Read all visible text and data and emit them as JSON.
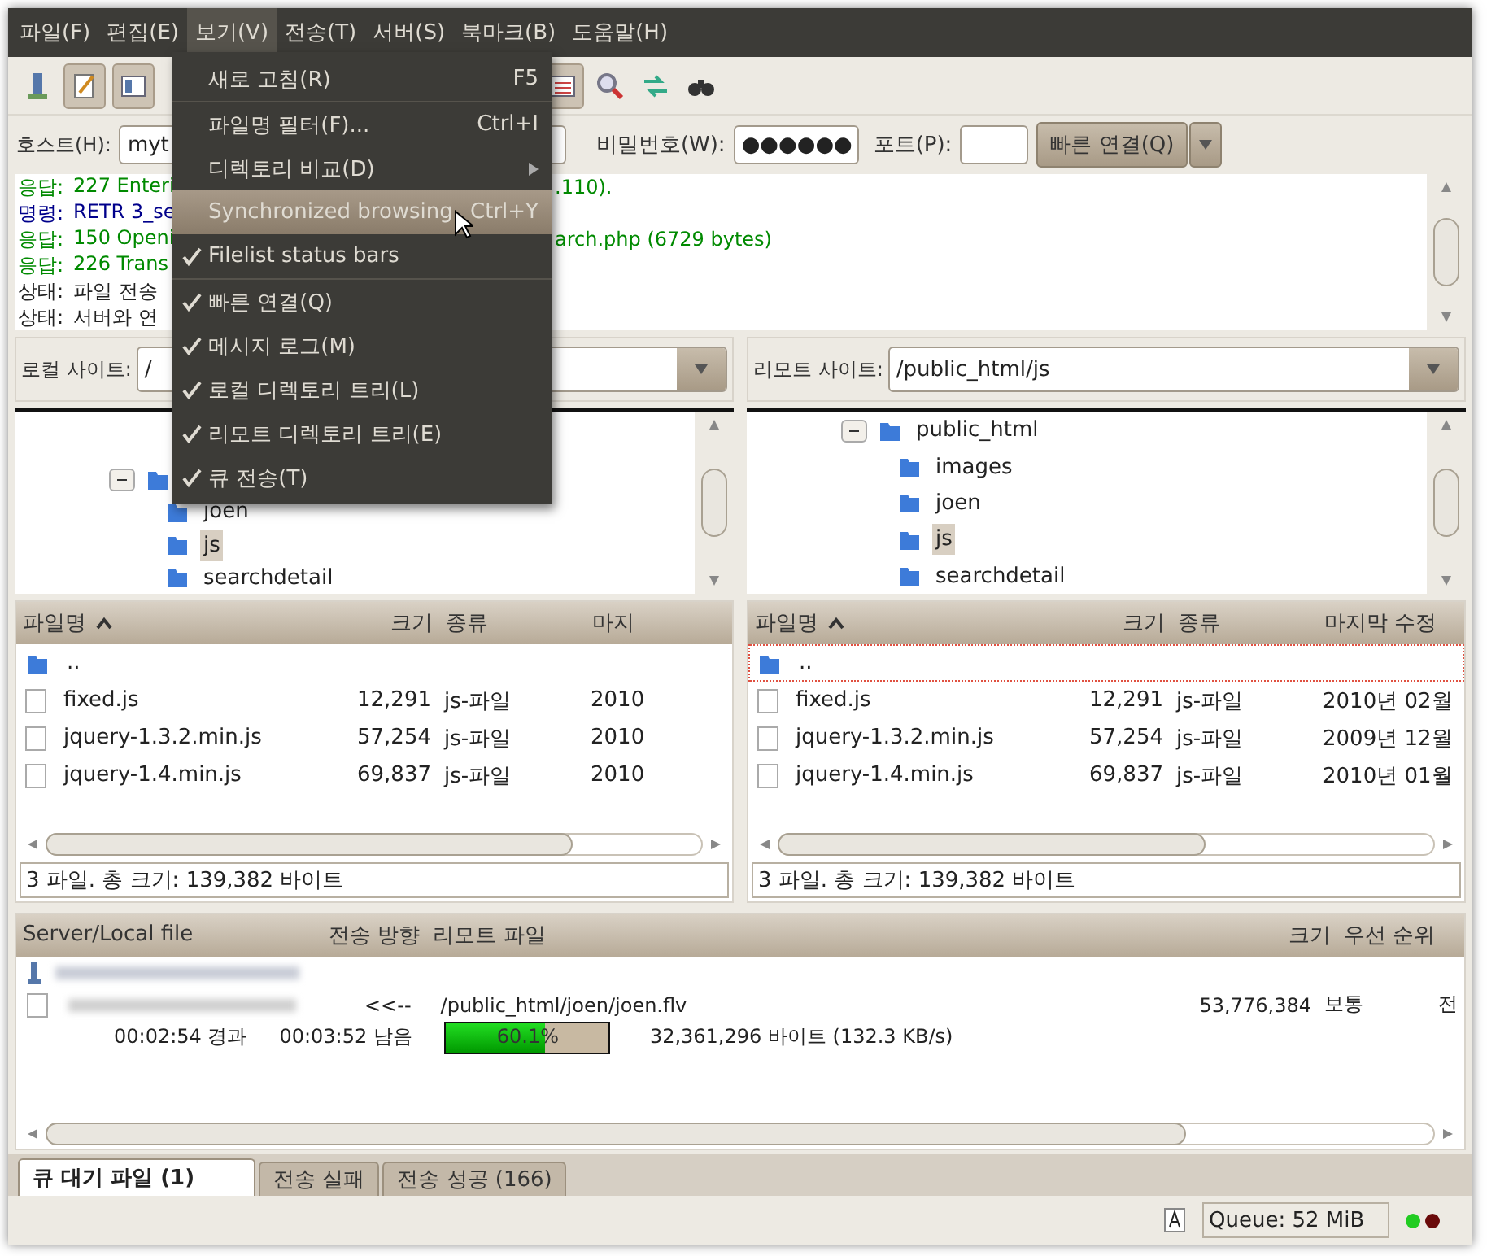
{
  "menubar": [
    {
      "label": "파일(F)",
      "selected": false
    },
    {
      "label": "편집(E)",
      "selected": false
    },
    {
      "label": "보기(V)",
      "selected": true
    },
    {
      "label": "전송(T)",
      "selected": false
    },
    {
      "label": "서버(S)",
      "selected": false
    },
    {
      "label": "북마크(B)",
      "selected": false
    },
    {
      "label": "도움말(H)",
      "selected": false
    }
  ],
  "view_menu": [
    {
      "kind": "item",
      "label": "새로 고침(R)",
      "shortcut": "F5",
      "checked": false,
      "highlighted": false
    },
    {
      "kind": "separator"
    },
    {
      "kind": "item",
      "label": "파일명 필터(F)...",
      "shortcut": "Ctrl+I",
      "checked": false,
      "highlighted": false
    },
    {
      "kind": "submenu",
      "label": "디렉토리 비교(D)",
      "checked": false,
      "highlighted": false
    },
    {
      "kind": "item",
      "label": "Synchronized browsing",
      "shortcut": "Ctrl+Y",
      "checked": false,
      "highlighted": true
    },
    {
      "kind": "item",
      "label": "Filelist status bars",
      "checked": true,
      "highlighted": false
    },
    {
      "kind": "separator"
    },
    {
      "kind": "item",
      "label": "빠른 연결(Q)",
      "checked": true,
      "highlighted": false
    },
    {
      "kind": "item",
      "label": "메시지 로그(M)",
      "checked": true,
      "highlighted": false
    },
    {
      "kind": "item",
      "label": "로컬 디렉토리 트리(L)",
      "checked": true,
      "highlighted": false
    },
    {
      "kind": "item",
      "label": "리모트 디렉토리 트리(E)",
      "checked": true,
      "highlighted": false
    },
    {
      "kind": "item",
      "label": "큐 전송(T)",
      "checked": true,
      "highlighted": false
    }
  ],
  "quickconnect": {
    "host_label": "호스트(H):",
    "host_value": "myt",
    "password_label": "비밀번호(W):",
    "password_value": "●●●●●●",
    "port_label": "포트(P):",
    "connect_button": "빠른 연결(Q)"
  },
  "log": [
    {
      "kind": "response",
      "label": "응답:",
      "text": "227 Enteri",
      "tail": ".110)."
    },
    {
      "kind": "command",
      "label": "명령:",
      "text": "RETR 3_se"
    },
    {
      "kind": "response",
      "label": "응답:",
      "text": "150 Openi",
      "tail": "arch.php (6729 bytes)"
    },
    {
      "kind": "response",
      "label": "응답:",
      "text": "226 Trans"
    },
    {
      "kind": "status",
      "label": "상태:",
      "text": "파일 전송"
    },
    {
      "kind": "status",
      "label": "상태:",
      "text": "서버와 연"
    }
  ],
  "local": {
    "site_label": "로컬 사이트:",
    "path": "/",
    "tree": {
      "expanded": true,
      "children": [
        {
          "label": "joen",
          "selected": false
        },
        {
          "label": "js",
          "selected": true
        },
        {
          "label": "searchdetail",
          "selected": false
        }
      ]
    },
    "columns": [
      "파일명",
      "크기",
      "종류",
      "마지"
    ],
    "rows": [
      {
        "kind": "folder",
        "name": "..",
        "focused": false
      },
      {
        "kind": "file",
        "name": "fixed.js",
        "size": "12,291",
        "type": "js-파일",
        "modified": "2010",
        "focused": false
      },
      {
        "kind": "file",
        "name": "jquery-1.3.2.min.js",
        "size": "57,254",
        "type": "js-파일",
        "modified": "2010",
        "focused": false
      },
      {
        "kind": "file",
        "name": "jquery-1.4.min.js",
        "size": "69,837",
        "type": "js-파일",
        "modified": "2010",
        "focused": false
      }
    ],
    "status": "3 파일. 총 크기: 139,382 바이트"
  },
  "remote": {
    "site_label": "리모트 사이트:",
    "path": "/public_html/js",
    "tree": {
      "label": "public_html",
      "expanded": true,
      "children": [
        {
          "label": "images",
          "selected": false
        },
        {
          "label": "joen",
          "selected": false
        },
        {
          "label": "js",
          "selected": true
        },
        {
          "label": "searchdetail",
          "selected": false
        }
      ]
    },
    "columns": [
      "파일명",
      "크기",
      "종류",
      "마지막 수정"
    ],
    "rows": [
      {
        "kind": "folder",
        "name": "..",
        "focused": true
      },
      {
        "kind": "file",
        "name": "fixed.js",
        "size": "12,291",
        "type": "js-파일",
        "modified": "2010년 02월",
        "focused": false
      },
      {
        "kind": "file",
        "name": "jquery-1.3.2.min.js",
        "size": "57,254",
        "type": "js-파일",
        "modified": "2009년 12월",
        "focused": false
      },
      {
        "kind": "file",
        "name": "jquery-1.4.min.js",
        "size": "69,837",
        "type": "js-파일",
        "modified": "2010년 01월",
        "focused": false
      }
    ],
    "status": "3 파일. 총 크기: 139,382 바이트"
  },
  "queue": {
    "columns": [
      "Server/Local file",
      "전송 방향",
      "리모트 파일",
      "크기",
      "우선 순위"
    ],
    "file": {
      "direction": "<<--",
      "remote": "/public_html/joen/joen.flv",
      "size": "53,776,384",
      "priority": "보통",
      "status": "전"
    },
    "progress": {
      "elapsed": "00:02:54 경과",
      "remaining": "00:03:52 남음",
      "level": 0.601,
      "percent": "60.1%",
      "transferred": "32,361,296 바이트 (132.3 KB/s)"
    }
  },
  "tabs": [
    {
      "label": "큐 대기 파일 (1)",
      "selected": true
    },
    {
      "label": "전송 실패",
      "selected": false
    },
    {
      "label": "전송 성공 (166)",
      "selected": false
    }
  ],
  "status_bar": {
    "queue": "Queue: 52 MiB",
    "lights": [
      {
        "color": "#22cc22"
      },
      {
        "color": "#6a0a0a"
      }
    ]
  }
}
